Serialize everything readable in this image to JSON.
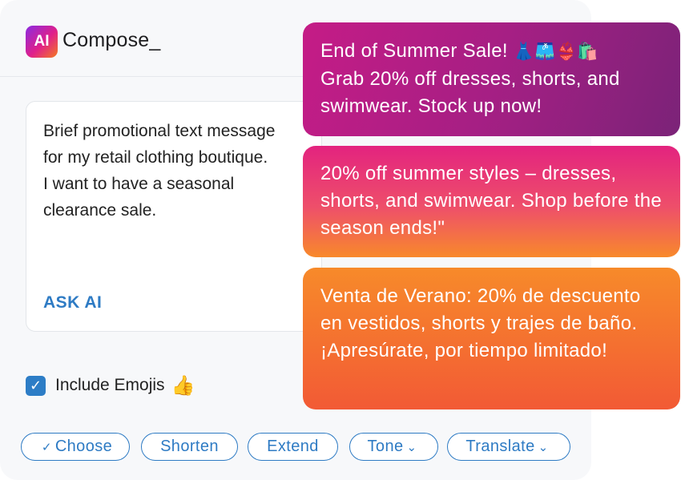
{
  "app": {
    "logo_text": "AI",
    "title": "Compose_"
  },
  "prompt": {
    "text": "Brief promotional text message for my retail clothing boutique. I want to have a seasonal clearance sale.",
    "ask_label": "ASK AI"
  },
  "options": {
    "include_emojis_label": "Include Emojis",
    "include_emojis_checked": true,
    "emoji": "👍"
  },
  "actions": [
    {
      "label": "Choose",
      "icon": "check-icon"
    },
    {
      "label": "Shorten"
    },
    {
      "label": "Extend"
    },
    {
      "label": "Tone",
      "icon": "chevron-down-icon"
    },
    {
      "label": "Translate",
      "icon": "chevron-down-icon"
    }
  ],
  "suggestions": [
    {
      "line1": "End of Summer Sale! ",
      "emoji": "👗🩳👙🛍️",
      "rest": "Grab 20% off dresses, shorts, and swimwear. Stock up now!"
    },
    {
      "text": "20% off summer styles – dresses, shorts, and swimwear. Shop before the season ends!\""
    },
    {
      "text": "Venta de Verano: 20% de descuento en vestidos, shorts y trajes de baño. ¡Apresúrate, por tiempo limitado!"
    }
  ],
  "colors": {
    "accent": "#2e7bc4",
    "brand_gradient": [
      "#8a2be2",
      "#e0208a",
      "#f47a1f"
    ]
  }
}
